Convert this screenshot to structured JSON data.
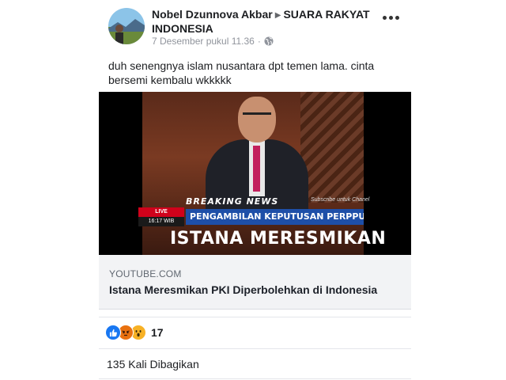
{
  "post": {
    "author": "Nobel Dzunnova Akbar",
    "group": "SUARA RAKYAT INDONESIA",
    "timestamp": "7 Desember pukul 11.36",
    "privacy_icon": "globe-icon",
    "text": "duh senengnya islam nusantara dpt temen lama. cinta bersemi kembalu wkkkkk"
  },
  "video": {
    "breaking_label": "BREAKING NEWS",
    "subscribe_text": "Subscribe untuk Chanel",
    "live_label": "LIVE",
    "time_label": "16:17 WIB",
    "ticker_text": "PENGAMBILAN KEPUTUSAN PERPPU ORMAS",
    "headline": "ISTANA MERESMIKAN"
  },
  "link_card": {
    "domain": "YOUTUBE.COM",
    "title": "Istana Meresmikan PKI Diperbolehkan di Indonesia"
  },
  "reactions": {
    "types": [
      "like",
      "angry",
      "wow"
    ],
    "count": "17"
  },
  "shares": {
    "text": "135 Kali Dibagikan"
  },
  "colors": {
    "like": "#1877f2",
    "angry": "#e9710f",
    "wow": "#f7b125",
    "ticker": "#1e4fa8",
    "live": "#d0021b"
  }
}
